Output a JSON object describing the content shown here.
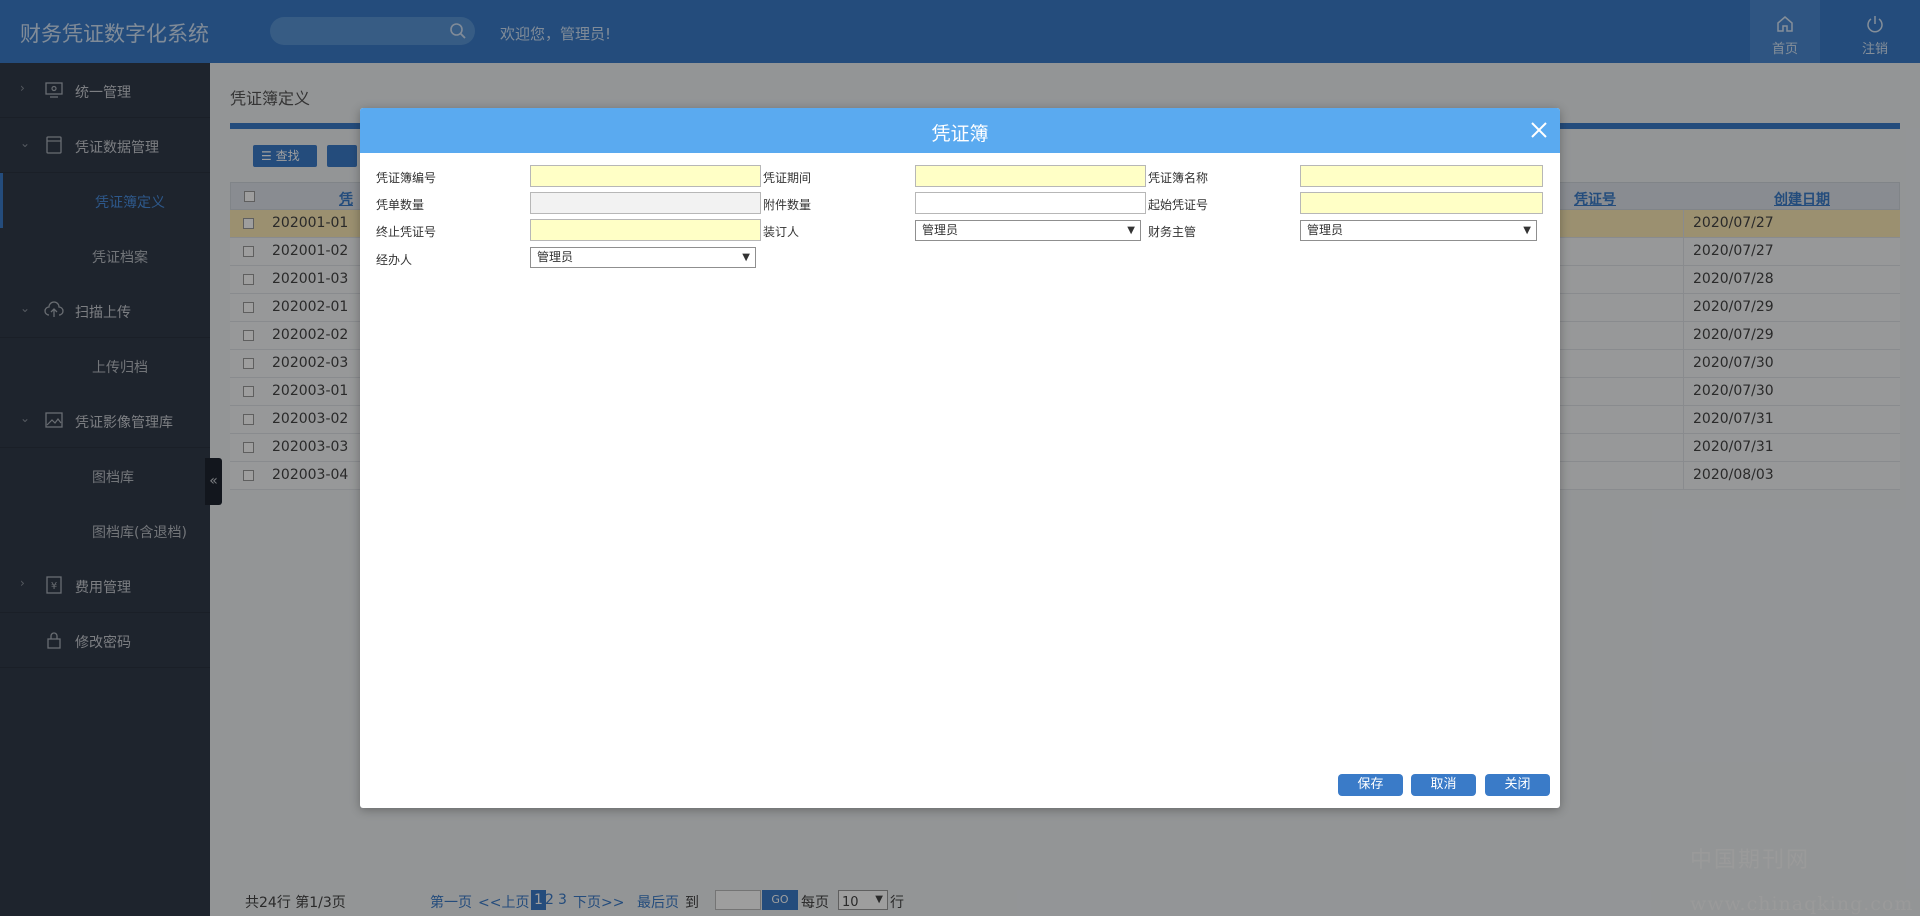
{
  "header": {
    "app_title": "财务凭证数字化系统",
    "welcome": "欢迎您，管理员!",
    "home_label": "首页",
    "logout_label": "注销"
  },
  "sidebar": {
    "items": [
      {
        "label": "统一管理",
        "type": "group",
        "icon": "monitor-icon"
      },
      {
        "label": "凭证数据管理",
        "type": "group",
        "icon": "book-icon"
      },
      {
        "label": "凭证簿定义",
        "type": "sub",
        "active": true
      },
      {
        "label": "凭证档案",
        "type": "sub"
      },
      {
        "label": "扫描上传",
        "type": "group",
        "icon": "cloud-upload-icon"
      },
      {
        "label": "上传归档",
        "type": "sub"
      },
      {
        "label": "凭证影像管理库",
        "type": "group",
        "icon": "image-icon"
      },
      {
        "label": "图档库",
        "type": "sub"
      },
      {
        "label": "图档库(含退档)",
        "type": "sub"
      },
      {
        "label": "费用管理",
        "type": "group",
        "icon": "yen-doc-icon"
      },
      {
        "label": "修改密码",
        "type": "group",
        "icon": "lock-icon"
      }
    ],
    "collapse_glyph": "«"
  },
  "main": {
    "page_title": "凭证簿定义",
    "find_button": "查找",
    "columns": {
      "col1": "凭",
      "col_voucher": "凭证号",
      "col_created": "创建日期"
    },
    "rows": [
      {
        "num": "202001-01",
        "date": "2020/07/27"
      },
      {
        "num": "202001-02",
        "date": "2020/07/27"
      },
      {
        "num": "202001-03",
        "date": "2020/07/28"
      },
      {
        "num": "202002-01",
        "date": "2020/07/29"
      },
      {
        "num": "202002-02",
        "date": "2020/07/29"
      },
      {
        "num": "202002-03",
        "date": "2020/07/30"
      },
      {
        "num": "202003-01",
        "date": "2020/07/30"
      },
      {
        "num": "202003-02",
        "date": "2020/07/31"
      },
      {
        "num": "202003-03",
        "date": "2020/07/31"
      },
      {
        "num": "202003-04",
        "date": "2020/08/03"
      }
    ],
    "pager": {
      "summary": "共24行 第1/3页",
      "first": "第一页",
      "prev": "<<上页",
      "page1": "1",
      "page2": "2",
      "page3": "3",
      "next": "下页>>",
      "last": "最后页",
      "goto_label": "到",
      "go": "GO",
      "per_page_label": "每页",
      "per_page_value": "10",
      "row_unit": "行"
    }
  },
  "modal": {
    "title": "凭证簿",
    "fields": {
      "book_no_label": "凭证簿编号",
      "period_label": "凭证期间",
      "book_name_label": "凭证簿名称",
      "voucher_count_label": "凭单数量",
      "attachment_count_label": "附件数量",
      "start_no_label": "起始凭证号",
      "end_no_label": "终止凭证号",
      "binder_label": "装订人",
      "binder_value": "管理员",
      "finance_head_label": "财务主管",
      "finance_head_value": "管理员",
      "handler_label": "经办人",
      "handler_value": "管理员"
    },
    "buttons": {
      "save": "保存",
      "cancel": "取消",
      "close": "关闭"
    }
  },
  "watermark": {
    "cn": "中国期刊网",
    "url": "www.chinaqking.com"
  }
}
